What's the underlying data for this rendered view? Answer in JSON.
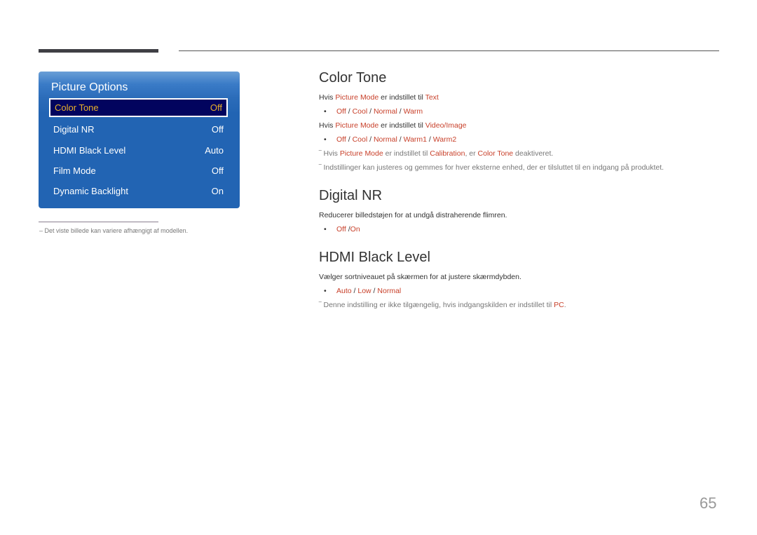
{
  "panel": {
    "title": "Picture Options",
    "items": [
      {
        "label": "Color Tone",
        "value": "Off",
        "selected": true
      },
      {
        "label": "Digital NR",
        "value": "Off"
      },
      {
        "label": "HDMI Black Level",
        "value": "Auto"
      },
      {
        "label": "Film Mode",
        "value": "Off"
      },
      {
        "label": "Dynamic Backlight",
        "value": "On"
      }
    ]
  },
  "footnote": "–  Det viste billede kan variere afhængigt af modellen.",
  "sections": {
    "color_tone": {
      "title": "Color Tone",
      "line1": {
        "pre": "Hvis ",
        "hl1": "Picture Mode",
        "mid": " er indstillet til ",
        "hl2": "Text"
      },
      "options1": [
        "Off",
        "Cool",
        "Normal",
        "Warm"
      ],
      "line2": {
        "pre": "Hvis ",
        "hl1": "Picture Mode",
        "mid": " er indstillet til ",
        "hl2": "Video/Image"
      },
      "options2": [
        "Off",
        "Cool",
        "Normal",
        "Warm1",
        "Warm2"
      ],
      "note1": {
        "pre": "Hvis ",
        "hl1": "Picture Mode",
        "mid": " er indstillet til ",
        "hl2": "Calibration",
        "mid2": ", er ",
        "hl3": "Color Tone",
        "post": " deaktiveret."
      },
      "note2": "Indstillinger kan justeres og gemmes for hver eksterne enhed, der er tilsluttet til en indgang på produktet."
    },
    "digital_nr": {
      "title": "Digital NR",
      "desc": "Reducerer billedstøjen for at undgå distraherende flimren.",
      "options": [
        "Off",
        "On"
      ]
    },
    "hdmi_black_level": {
      "title": "HDMI Black Level",
      "desc": "Vælger sortniveauet på skærmen for at justere skærmdybden.",
      "options": [
        "Auto",
        "Low",
        "Normal"
      ],
      "note": {
        "pre": "Denne indstilling er ikke tilgængelig, hvis indgangskilden er indstillet til ",
        "hl": "PC",
        "post": "."
      }
    }
  },
  "symbols": {
    "bullet": "•",
    "note_dash": "‾",
    "sep": " / "
  },
  "colors": {
    "highlight": "#c8402a",
    "panel_blue": "#2264b3",
    "selected_bg": "#02045e",
    "selected_text": "#e8b02a"
  },
  "page_number": "65"
}
